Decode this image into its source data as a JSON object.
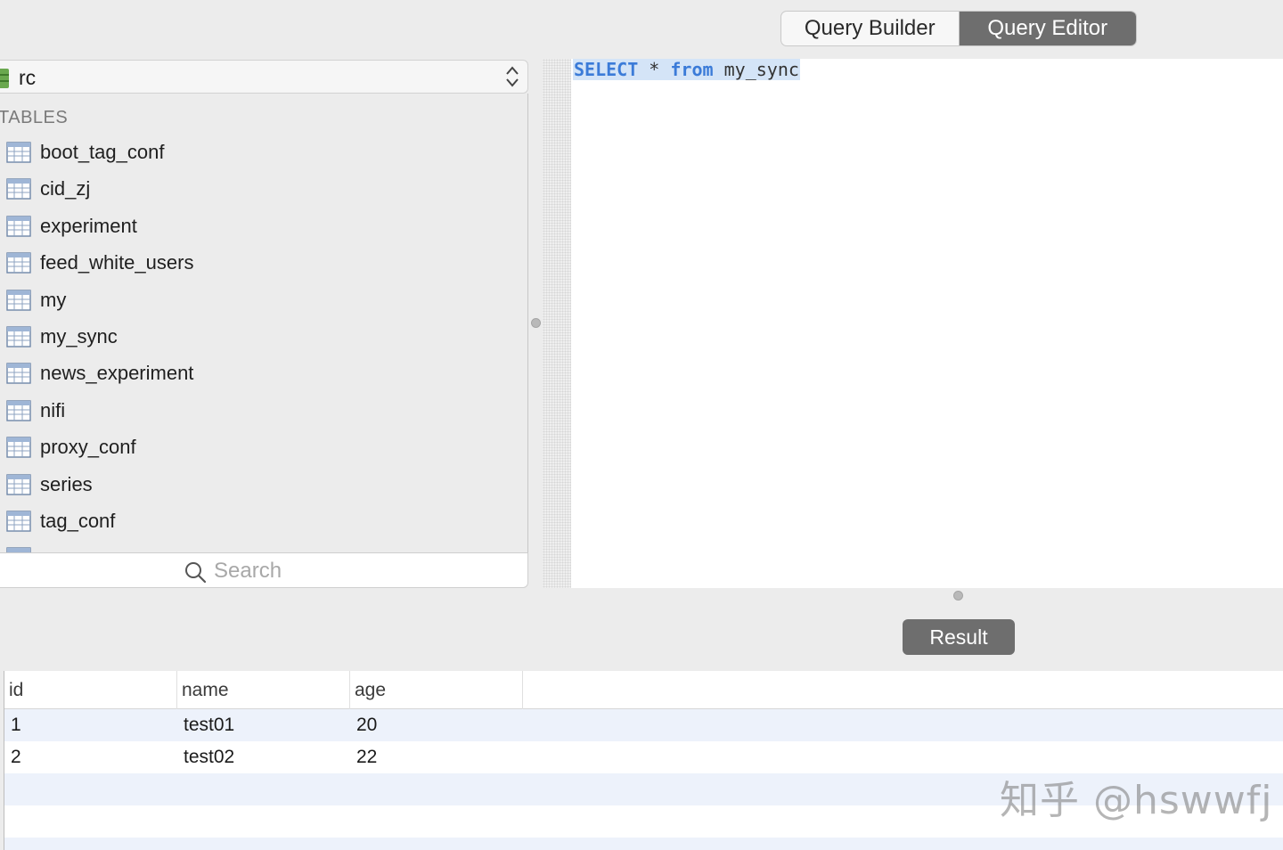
{
  "mode_switch": {
    "query_builder": "Query Builder",
    "query_editor": "Query Editor",
    "active": "Query Editor"
  },
  "database": {
    "name": "rc"
  },
  "sidebar": {
    "section_title": "TABLES",
    "tables": [
      "boot_tag_conf",
      "cid_zj",
      "experiment",
      "feed_white_users",
      "my",
      "my_sync",
      "news_experiment",
      "nifi",
      "proxy_conf",
      "series",
      "tag_conf"
    ],
    "search_placeholder": "Search"
  },
  "editor": {
    "sql": {
      "kw_select": "SELECT",
      "star": "*",
      "kw_from": "from",
      "table": "my_sync"
    }
  },
  "result": {
    "tab_label": "Result",
    "columns": [
      "id",
      "name",
      "age"
    ],
    "rows": [
      [
        "1",
        "test01",
        "20"
      ],
      [
        "2",
        "test02",
        "22"
      ]
    ]
  },
  "watermark": "知乎 @hswwfj",
  "colors": {
    "segment_active": "#6e6e6e",
    "sql_keyword": "#3b7bd8",
    "sql_highlight": "#d4e4f7",
    "row_alt": "#edf2fb"
  }
}
